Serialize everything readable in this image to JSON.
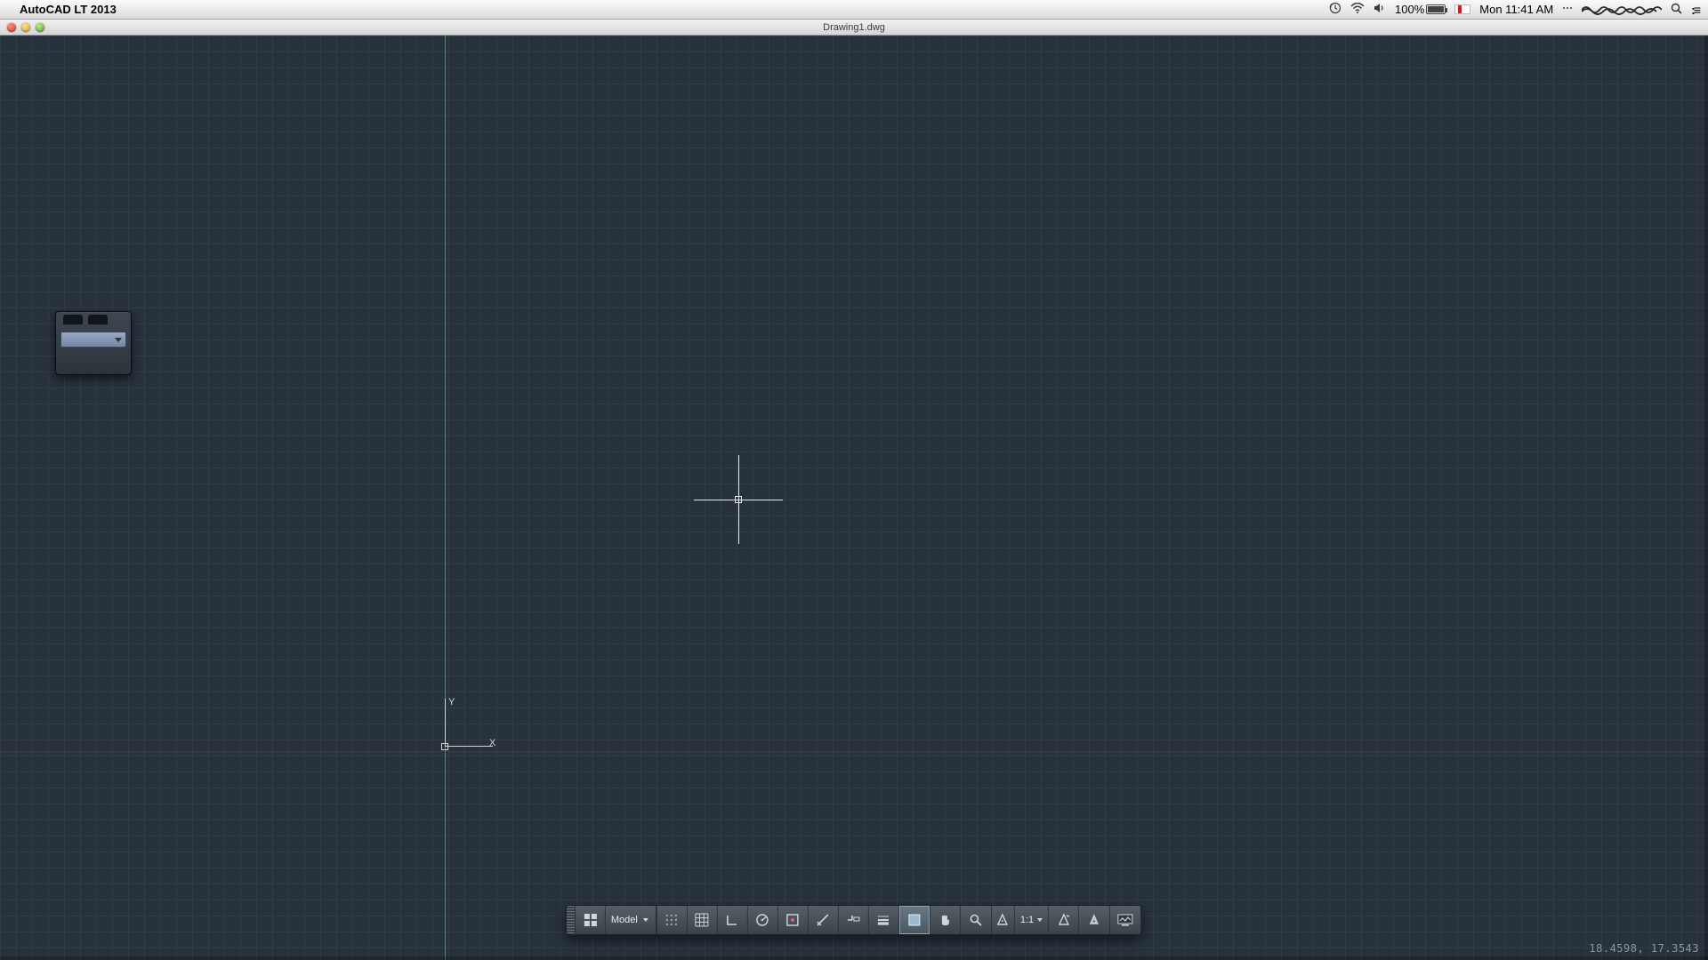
{
  "menubar": {
    "app_name": "AutoCAD LT 2013",
    "battery_pct": "100%",
    "clock": "Mon 11:41 AM",
    "icons": [
      "timemachine",
      "wifi",
      "volume",
      "battery",
      "flag",
      "clock"
    ]
  },
  "window": {
    "title": "Drawing1.dwg"
  },
  "ucs": {
    "x_label": "X",
    "y_label": "Y"
  },
  "statusbar": {
    "model_label": "Model",
    "scale_label": "1:1",
    "buttons": [
      {
        "name": "workspace-switch",
        "hint": "workspace"
      },
      {
        "name": "model-paper",
        "hint": "model/paper"
      },
      {
        "name": "snap-toggle",
        "hint": "snap"
      },
      {
        "name": "grid-toggle",
        "hint": "grid"
      },
      {
        "name": "ortho-toggle",
        "hint": "ortho"
      },
      {
        "name": "polar-toggle",
        "hint": "polar"
      },
      {
        "name": "osnap-toggle",
        "hint": "osnap"
      },
      {
        "name": "otrack-toggle",
        "hint": "otrack"
      },
      {
        "name": "dynamic-input",
        "hint": "dyn"
      },
      {
        "name": "lineweight-toggle",
        "hint": "lw"
      },
      {
        "name": "transparency-toggle",
        "hint": "transparency",
        "active": true
      },
      {
        "name": "pan-tool",
        "hint": "pan"
      },
      {
        "name": "zoom-tool",
        "hint": "zoom"
      },
      {
        "name": "annotation-scale",
        "hint": "anno-scale"
      },
      {
        "name": "scale-list",
        "hint": "scale-list"
      },
      {
        "name": "annotation-visibility",
        "hint": "anno-vis"
      },
      {
        "name": "annotation-autoscale",
        "hint": "anno-auto"
      },
      {
        "name": "hardware-accel",
        "hint": "hw-accel"
      }
    ]
  },
  "coords": "18.4598, 17.3543"
}
